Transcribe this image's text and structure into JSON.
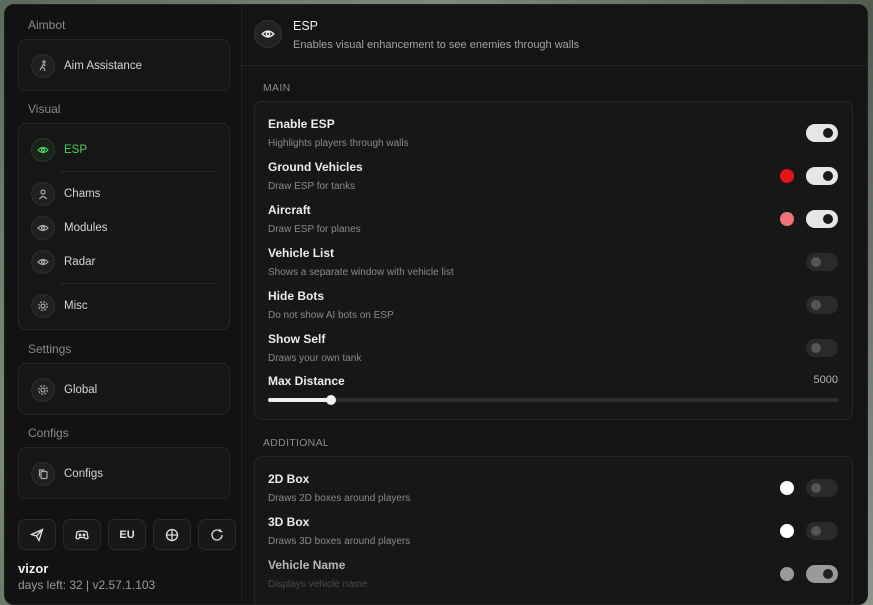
{
  "sidebar": {
    "sections": {
      "aimbot": "Aimbot",
      "visual": "Visual",
      "settings": "Settings",
      "configs": "Configs"
    },
    "items": {
      "aim_assistance": "Aim Assistance",
      "esp": "ESP",
      "chams": "Chams",
      "modules": "Modules",
      "radar": "Radar",
      "misc": "Misc",
      "global": "Global",
      "configs": "Configs"
    },
    "active": "esp",
    "region_button": "EU"
  },
  "user": {
    "name": "vizor",
    "meta": "days left: 32 | v2.57.1.103"
  },
  "header": {
    "title": "ESP",
    "subtitle": "Enables visual enhancement to see enemies through walls"
  },
  "main_section": {
    "label": "MAIN",
    "rows": [
      {
        "title": "Enable ESP",
        "desc": "Highlights players through walls",
        "toggle": "on",
        "swatch": null
      },
      {
        "title": "Ground Vehicles",
        "desc": "Draw ESP for tanks",
        "toggle": "on",
        "swatch": "#e3141a"
      },
      {
        "title": "Aircraft",
        "desc": "Draw ESP for planes",
        "toggle": "on",
        "swatch": "#f0757a"
      },
      {
        "title": "Vehicle List",
        "desc": "Shows a separate window with vehicle list",
        "toggle": "off",
        "swatch": null
      },
      {
        "title": "Hide Bots",
        "desc": "Do not show AI bots on ESP",
        "toggle": "off",
        "swatch": null
      },
      {
        "title": "Show Self",
        "desc": "Draws your own tank",
        "toggle": "off",
        "swatch": null
      }
    ],
    "slider": {
      "title": "Max Distance",
      "value": "5000",
      "fraction": 0.11
    }
  },
  "additional_section": {
    "label": "ADDITIONAL",
    "rows": [
      {
        "title": "2D Box",
        "desc": "Draws 2D boxes around players",
        "toggle": "off",
        "swatch": "#ffffff"
      },
      {
        "title": "3D Box",
        "desc": "Draws 3D boxes around players",
        "toggle": "off",
        "swatch": "#ffffff"
      },
      {
        "title": "Vehicle Name",
        "desc": "Displays vehicle name",
        "toggle": "half",
        "swatch": "#9a9a9a"
      }
    ]
  },
  "colors": {
    "accent": "#4cd35a",
    "background": "#141414"
  }
}
